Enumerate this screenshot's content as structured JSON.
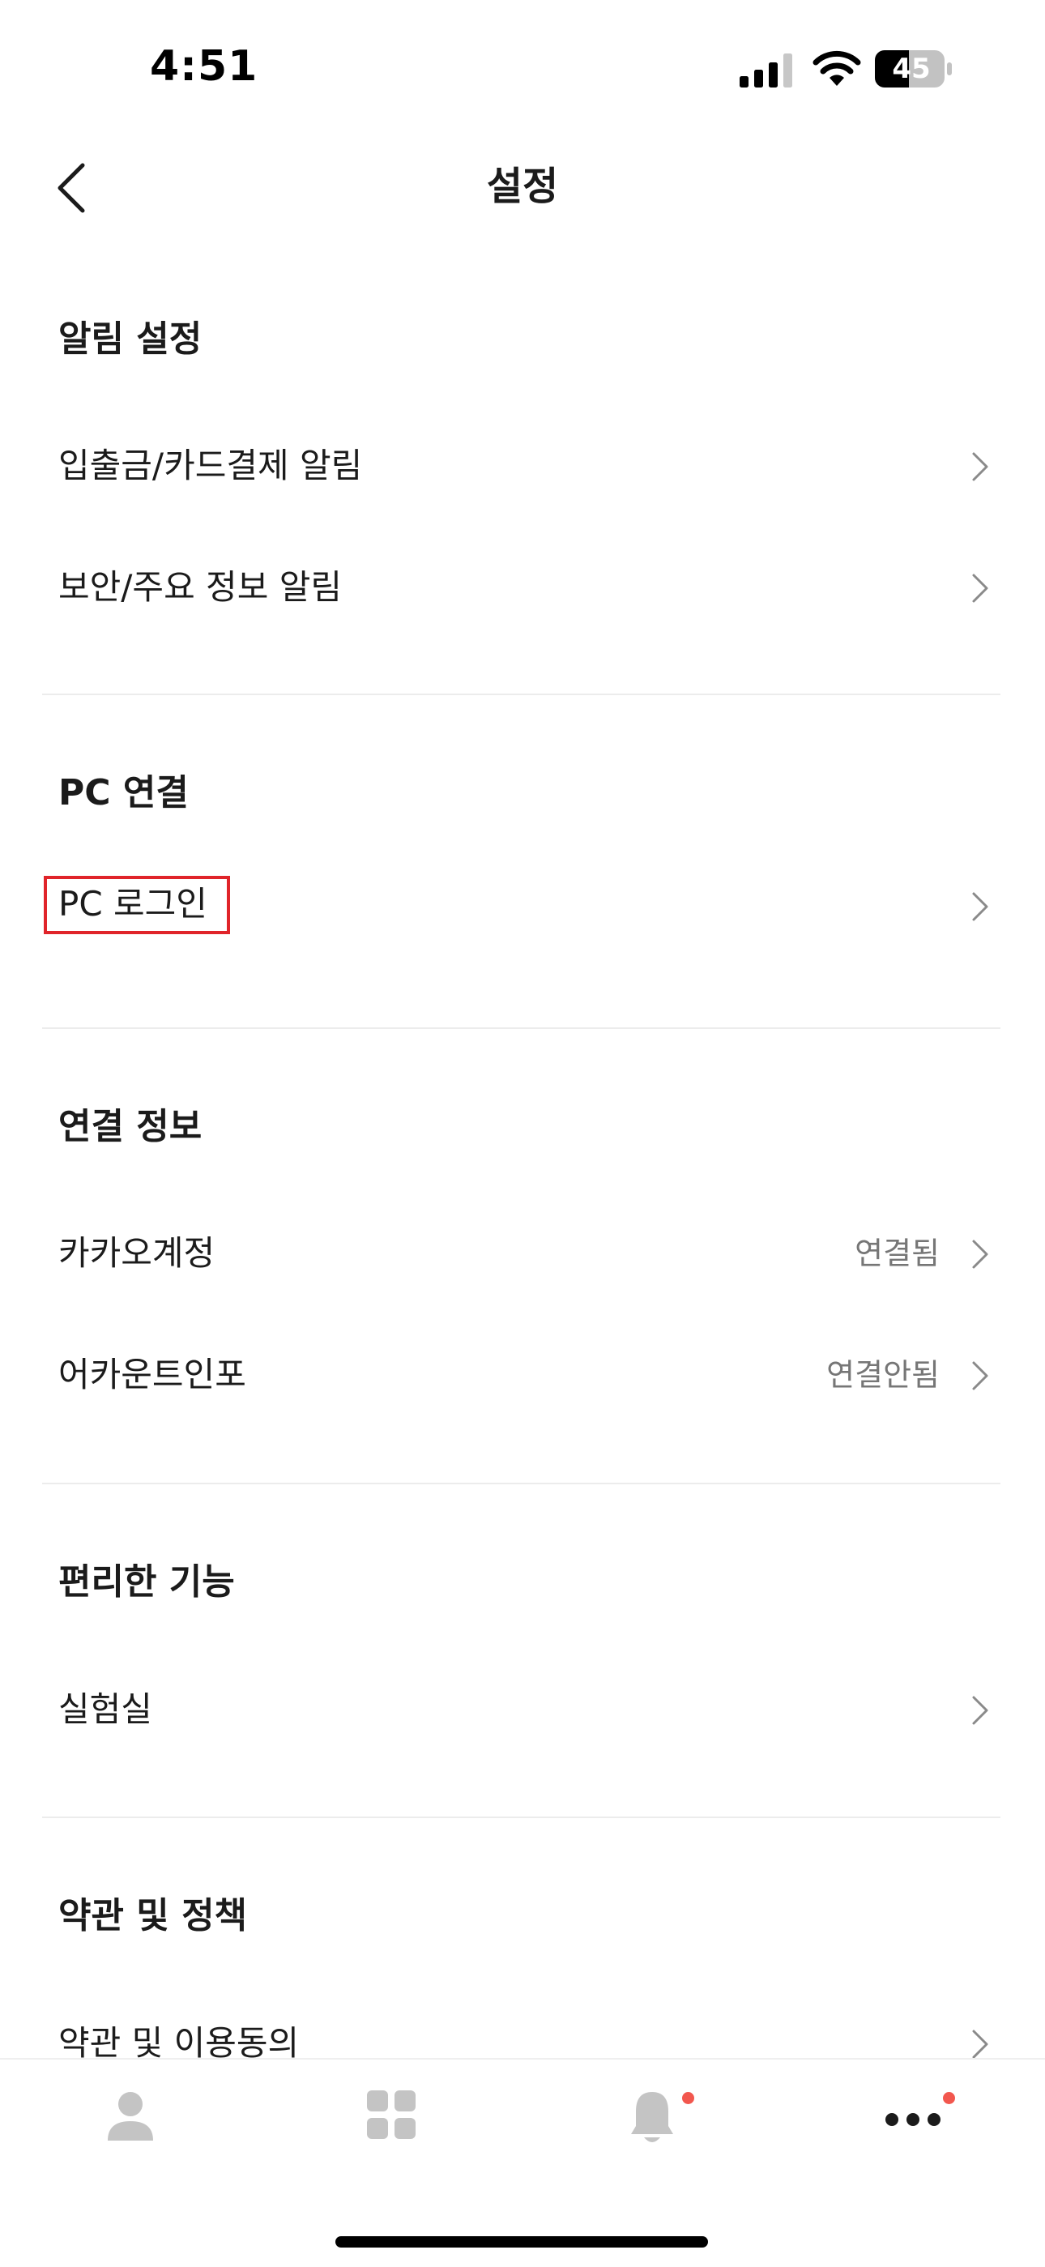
{
  "status_bar": {
    "time": "4:51",
    "battery": "45"
  },
  "header": {
    "title": "설정"
  },
  "sections": [
    {
      "title": "알림 설정",
      "items": [
        {
          "label": "입출금/카드결제 알림",
          "value": ""
        },
        {
          "label": "보안/주요 정보 알림",
          "value": ""
        }
      ]
    },
    {
      "title": "PC 연결",
      "items": [
        {
          "label": "PC 로그인",
          "value": ""
        }
      ]
    },
    {
      "title": "연결 정보",
      "items": [
        {
          "label": "카카오계정",
          "value": "연결됨"
        },
        {
          "label": "어카운트인포",
          "value": "연결안됨"
        }
      ]
    },
    {
      "title": "편리한 기능",
      "items": [
        {
          "label": "실험실",
          "value": ""
        }
      ]
    },
    {
      "title": "약관 및 정책",
      "items": [
        {
          "label": "약관 및 이용동의",
          "value": ""
        }
      ]
    }
  ],
  "tab_bar": {
    "tabs": [
      {
        "icon": "person-icon"
      },
      {
        "icon": "grid-icon"
      },
      {
        "icon": "bell-icon",
        "badge": true
      },
      {
        "icon": "more-icon",
        "badge": true
      }
    ],
    "badge_color": "#f2574e"
  },
  "colors": {
    "highlight": "#e0242a",
    "divider": "#ececec",
    "secondary_text": "#767676",
    "tab_icon": "#c4c4c4"
  }
}
